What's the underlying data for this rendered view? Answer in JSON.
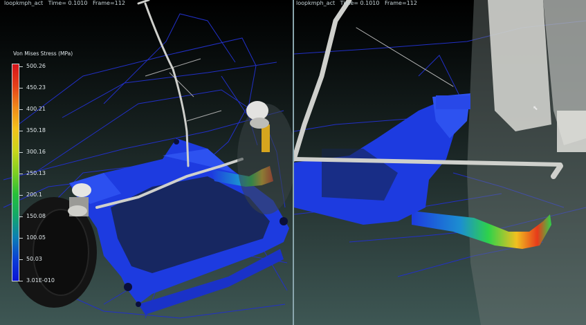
{
  "hud": {
    "left": {
      "result_name": "loopkmph_act",
      "time": "Time= 0.1010",
      "frame": "Frame=112"
    },
    "right": {
      "result_name": "loopkmph_act",
      "time": "Time= 0.1010",
      "frame": "Frame=112"
    }
  },
  "legend": {
    "title": "Von Mises Stress (MPa)",
    "ticks": [
      "500.26",
      "450.23",
      "400.21",
      "350.18",
      "300.16",
      "250.13",
      "200.1",
      "150.08",
      "100.05",
      "50.03",
      "3.01E-010"
    ],
    "colors": {
      "max": "#d6141b",
      "mid": "#7fcf22",
      "min": "#0a12d8"
    }
  },
  "colors": {
    "subframe": "#1d3be0",
    "wireframe": "#2230c8",
    "tire": "#141414",
    "chrome": "#cfd0cc"
  }
}
